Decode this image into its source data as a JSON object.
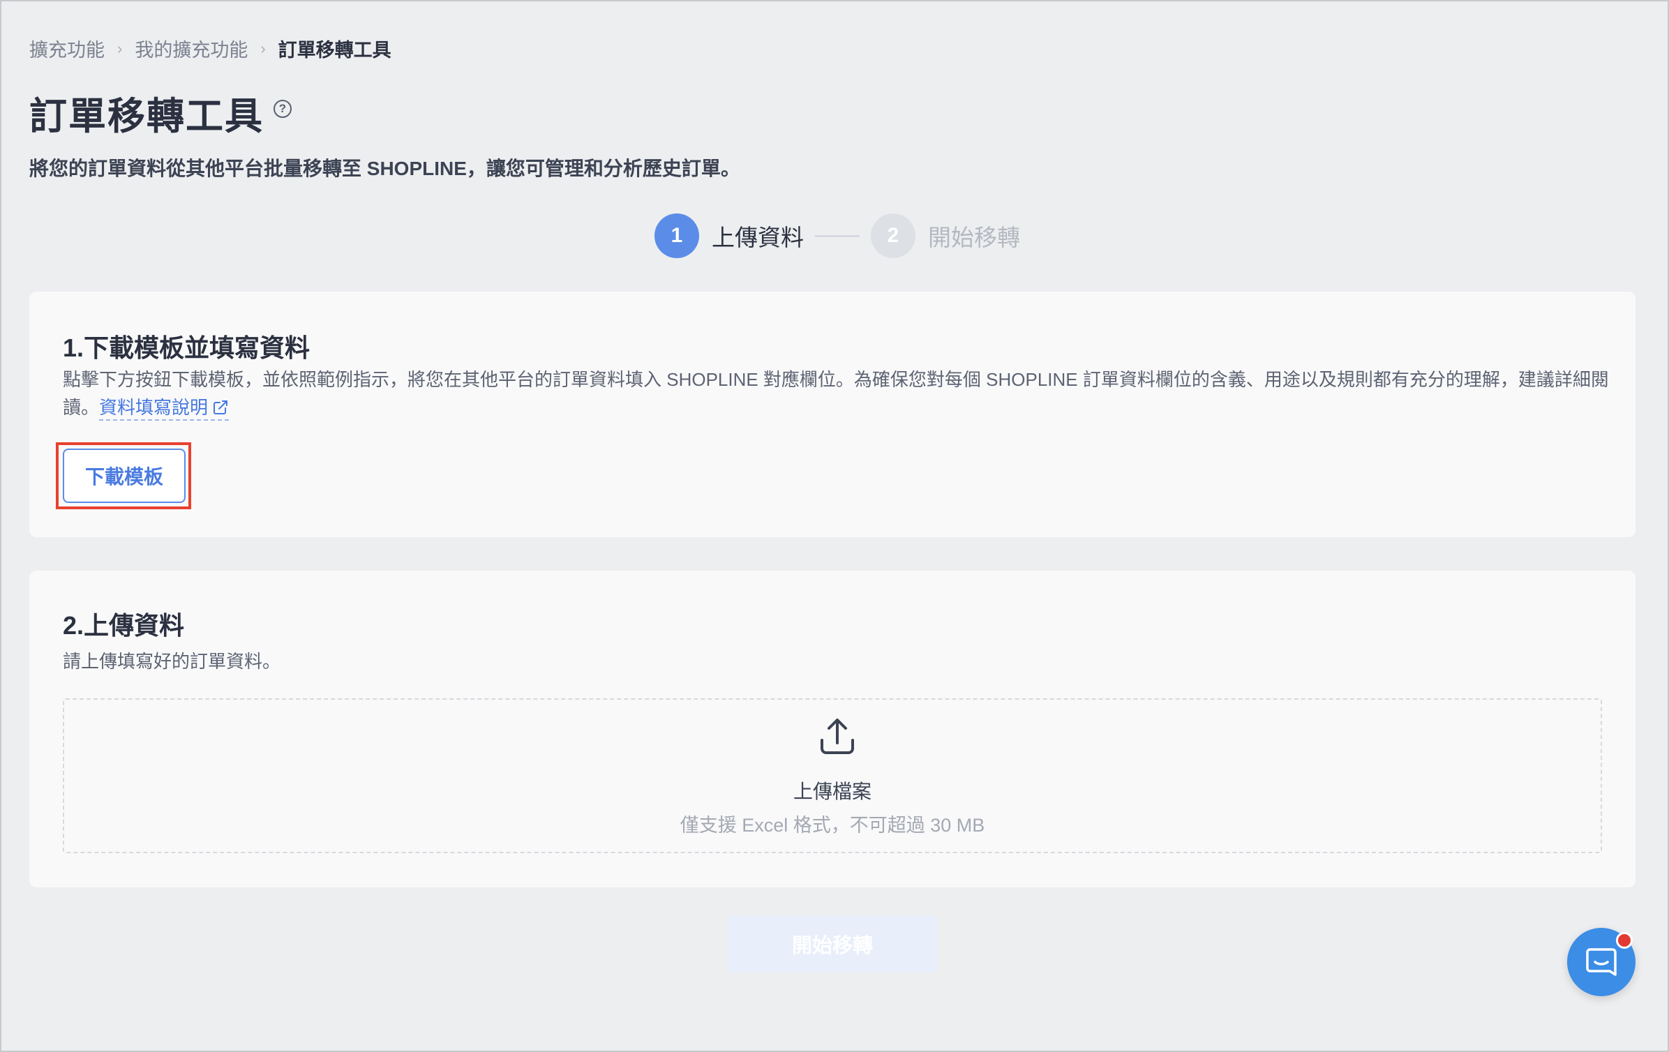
{
  "breadcrumb": {
    "items": [
      "擴充功能",
      "我的擴充功能"
    ],
    "current": "訂單移轉工具",
    "separator": "›"
  },
  "header": {
    "title": "訂單移轉工具",
    "help_symbol": "?",
    "subtitle": "將您的訂單資料從其他平台批量移轉至 SHOPLINE，讓您可管理和分析歷史訂單。"
  },
  "stepper": {
    "steps": [
      {
        "number": "1",
        "label": "上傳資料",
        "state": "active"
      },
      {
        "number": "2",
        "label": "開始移轉",
        "state": "inactive"
      }
    ]
  },
  "section1": {
    "title": "1.下載模板並填寫資料",
    "description": "點擊下方按鈕下載模板，並依照範例指示，將您在其他平台的訂單資料填入 SHOPLINE 對應欄位。為確保您對每個 SHOPLINE 訂單資料欄位的含義、用途以及規則都有充分的理解，建議詳細閱讀。",
    "link_label": "資料填寫說明",
    "link_icon": "external-link-icon",
    "download_button": "下載模板"
  },
  "section2": {
    "title": "2.上傳資料",
    "description": "請上傳填寫好的訂單資料。",
    "upload": {
      "icon": "upload-icon",
      "title": "上傳檔案",
      "hint": "僅支援 Excel 格式，不可超過 30 MB"
    }
  },
  "actions": {
    "start_button": "開始移轉",
    "start_disabled": true
  },
  "chat": {
    "icon": "chat-icon",
    "has_notification": true
  },
  "colors": {
    "accent": "#5b8ce8",
    "link": "#4578e0",
    "highlight": "#e8412e",
    "chat": "#3b8de6"
  }
}
